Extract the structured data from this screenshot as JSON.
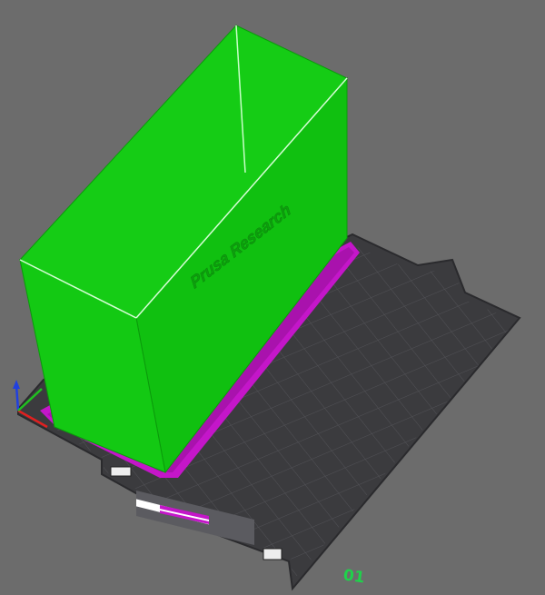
{
  "viewport": {
    "background": "#6c6c6c",
    "bed": {
      "plate_color": "#3b3b3e",
      "grid_color": "#56565a",
      "edge_color": "#2a2a2d",
      "plate_label": "01",
      "plate_label_color": "#1fd14b"
    },
    "model": {
      "name": "Prusa Research",
      "color": "#11c711",
      "color_dark": "#0ea60e",
      "outline_color": "#d8ffd8",
      "skirt_color": "#c416c9",
      "engraved_text": "Prusa Research"
    },
    "axes": {
      "x_icon": "x-axis-arrow-icon",
      "y_icon": "y-axis-arrow-icon",
      "z_icon": "z-axis-arrow-icon",
      "x_color": "#e02020",
      "y_color": "#20c020",
      "z_color": "#2040e0"
    },
    "bed_logo_icon": "printer-logo-icon",
    "bed_badge_icon": "plate-badge-icon"
  }
}
